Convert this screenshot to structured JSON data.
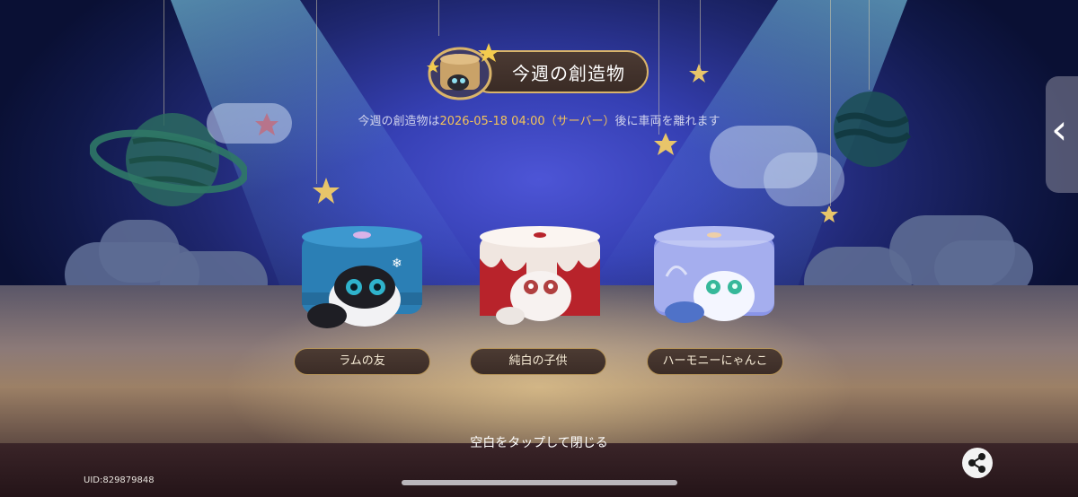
{
  "banner": {
    "title": "今週の創造物"
  },
  "subtitle": {
    "prefix": "今週の創造物は",
    "date": "2026-05-18 04:00（サーバー）",
    "suffix": "後に車両を離れます"
  },
  "items": [
    {
      "label": "ラムの友",
      "color": "#2b7fb5"
    },
    {
      "label": "純白の子供",
      "color": "#b8232b"
    },
    {
      "label": "ハーモニーにゃんこ",
      "color": "#8a95e8"
    }
  ],
  "hint": "空白をタップして閉じる",
  "uid": "UID:829879848",
  "icons": {
    "share": "share-icon",
    "side_tab": "chevron-left-icon"
  },
  "colors": {
    "accent_gold": "#f2c25a",
    "banner_bg": "#3a2b25",
    "banner_border": "#d9b46a"
  }
}
